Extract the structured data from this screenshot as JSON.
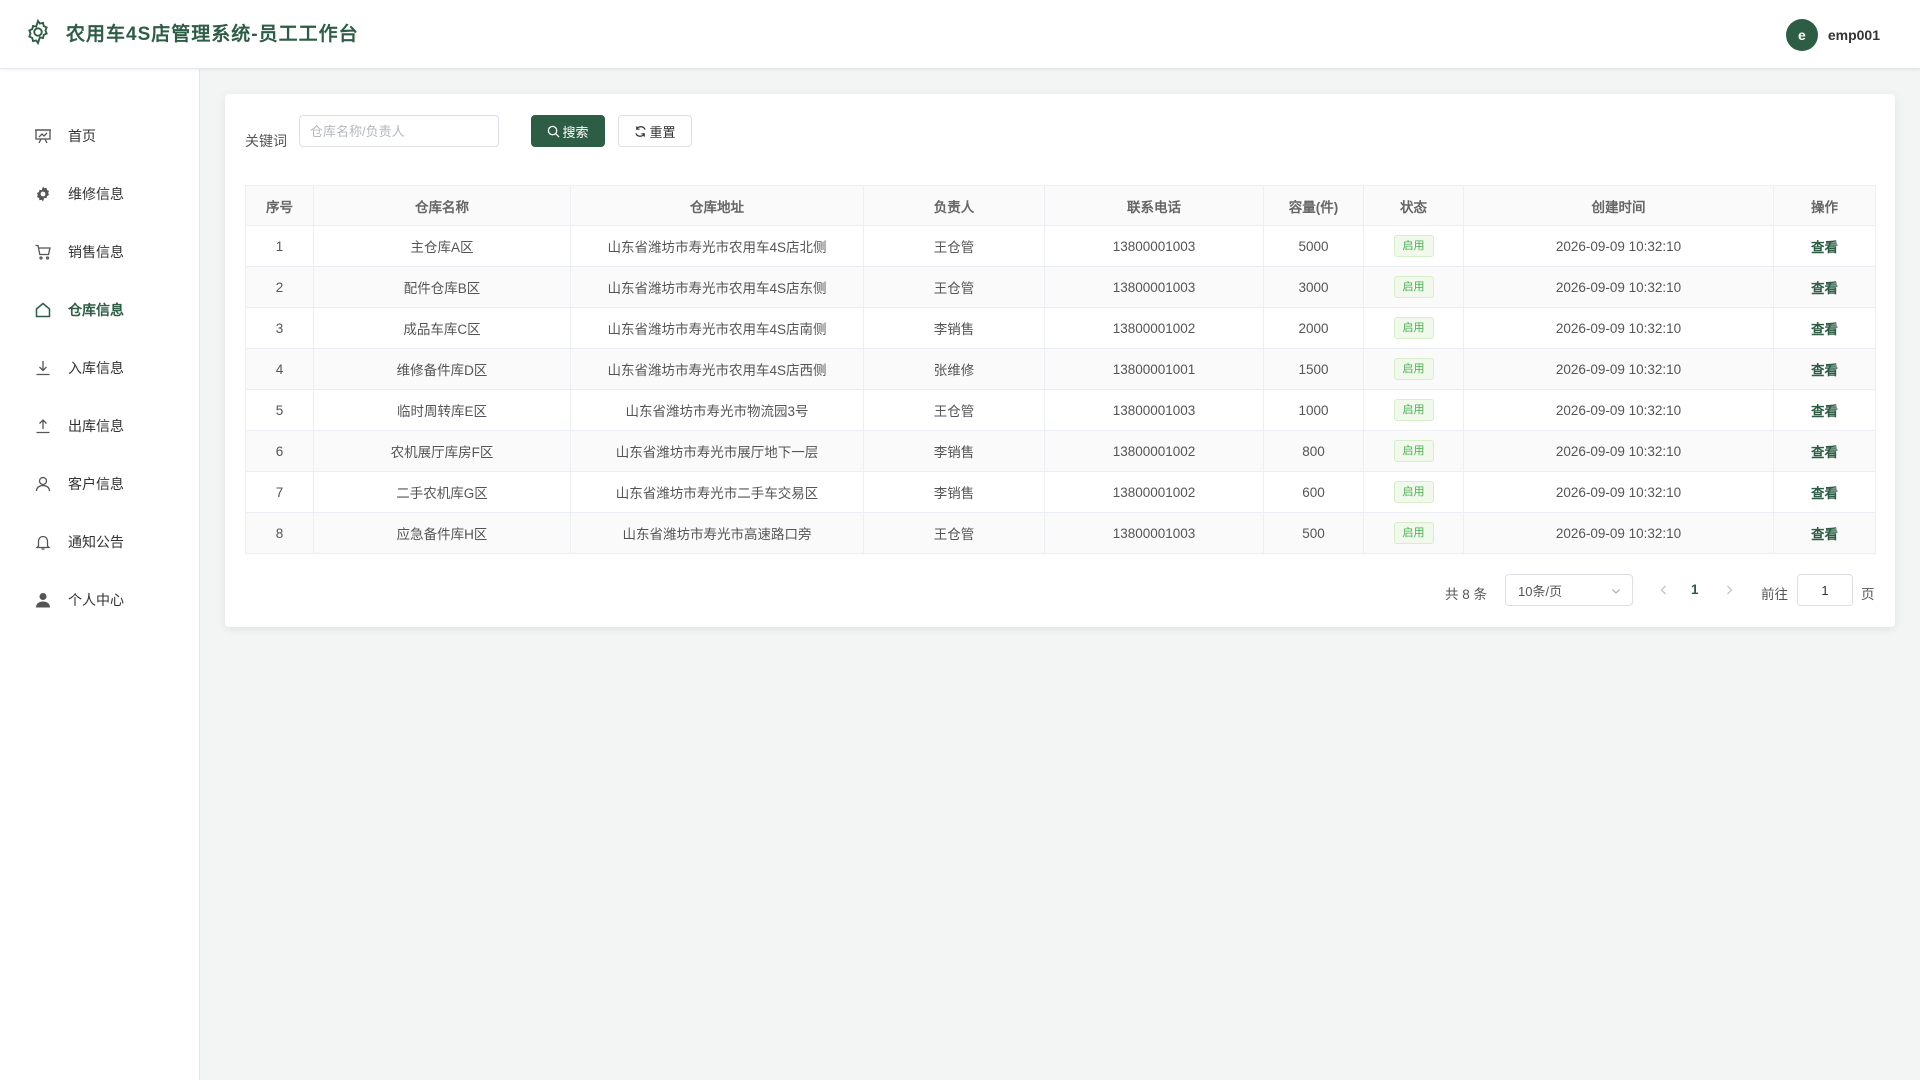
{
  "header": {
    "title": "农用车4S店管理系统-员工工作台",
    "avatar_letter": "e",
    "username": "emp001"
  },
  "sidebar": {
    "items": [
      {
        "label": "首页",
        "icon": "dashboard-icon"
      },
      {
        "label": "维修信息",
        "icon": "gear-icon"
      },
      {
        "label": "销售信息",
        "icon": "cart-icon"
      },
      {
        "label": "仓库信息",
        "icon": "home-icon",
        "active": true
      },
      {
        "label": "入库信息",
        "icon": "download-icon"
      },
      {
        "label": "出库信息",
        "icon": "upload-icon"
      },
      {
        "label": "客户信息",
        "icon": "user-icon"
      },
      {
        "label": "通知公告",
        "icon": "bell-icon"
      },
      {
        "label": "个人中心",
        "icon": "user-filled-icon"
      }
    ]
  },
  "search": {
    "label": "关键词",
    "placeholder": "仓库名称/负责人",
    "search_button": "搜索",
    "reset_button": "重置"
  },
  "table": {
    "columns": [
      "序号",
      "仓库名称",
      "仓库地址",
      "负责人",
      "联系电话",
      "容量(件)",
      "状态",
      "创建时间",
      "操作"
    ],
    "rows": [
      {
        "no": "1",
        "name": "主仓库A区",
        "address": "山东省潍坊市寿光市农用车4S店北侧",
        "manager": "王仓管",
        "phone": "13800001003",
        "capacity": "5000",
        "status": "启用",
        "created": "2026-09-09 10:32:10",
        "action": "查看"
      },
      {
        "no": "2",
        "name": "配件仓库B区",
        "address": "山东省潍坊市寿光市农用车4S店东侧",
        "manager": "王仓管",
        "phone": "13800001003",
        "capacity": "3000",
        "status": "启用",
        "created": "2026-09-09 10:32:10",
        "action": "查看"
      },
      {
        "no": "3",
        "name": "成品车库C区",
        "address": "山东省潍坊市寿光市农用车4S店南侧",
        "manager": "李销售",
        "phone": "13800001002",
        "capacity": "2000",
        "status": "启用",
        "created": "2026-09-09 10:32:10",
        "action": "查看"
      },
      {
        "no": "4",
        "name": "维修备件库D区",
        "address": "山东省潍坊市寿光市农用车4S店西侧",
        "manager": "张维修",
        "phone": "13800001001",
        "capacity": "1500",
        "status": "启用",
        "created": "2026-09-09 10:32:10",
        "action": "查看"
      },
      {
        "no": "5",
        "name": "临时周转库E区",
        "address": "山东省潍坊市寿光市物流园3号",
        "manager": "王仓管",
        "phone": "13800001003",
        "capacity": "1000",
        "status": "启用",
        "created": "2026-09-09 10:32:10",
        "action": "查看"
      },
      {
        "no": "6",
        "name": "农机展厅库房F区",
        "address": "山东省潍坊市寿光市展厅地下一层",
        "manager": "李销售",
        "phone": "13800001002",
        "capacity": "800",
        "status": "启用",
        "created": "2026-09-09 10:32:10",
        "action": "查看"
      },
      {
        "no": "7",
        "name": "二手农机库G区",
        "address": "山东省潍坊市寿光市二手车交易区",
        "manager": "李销售",
        "phone": "13800001002",
        "capacity": "600",
        "status": "启用",
        "created": "2026-09-09 10:32:10",
        "action": "查看"
      },
      {
        "no": "8",
        "name": "应急备件库H区",
        "address": "山东省潍坊市寿光市高速路口旁",
        "manager": "王仓管",
        "phone": "13800001003",
        "capacity": "500",
        "status": "启用",
        "created": "2026-09-09 10:32:10",
        "action": "查看"
      }
    ]
  },
  "pagination": {
    "total_text": "共 8 条",
    "page_size": "10条/页",
    "current_page": "1",
    "goto_label": "前往",
    "goto_value": "1",
    "page_unit": "页"
  },
  "colors": {
    "primary": "#2d5d45",
    "status_green": "#4caf50",
    "background": "#f3f5f4"
  }
}
